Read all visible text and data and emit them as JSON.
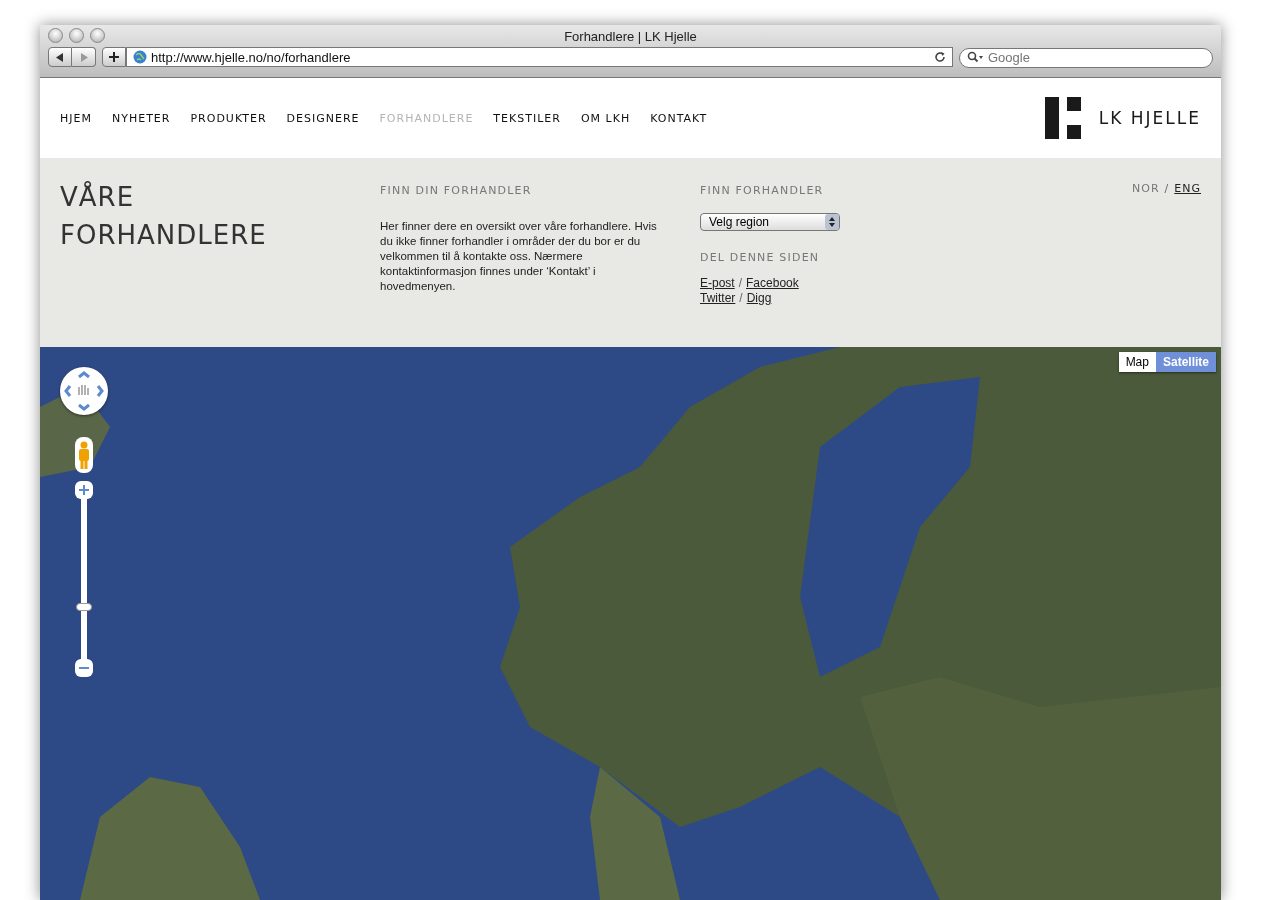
{
  "window": {
    "title": "Forhandlere | LK Hjelle"
  },
  "toolbar": {
    "url": "http://www.hjelle.no/no/forhandlere",
    "search_placeholder": "Google"
  },
  "nav": [
    {
      "label": "HJEM",
      "selected": false
    },
    {
      "label": "NYHETER",
      "selected": false
    },
    {
      "label": "PRODUKTER",
      "selected": false
    },
    {
      "label": "DESIGNERE",
      "selected": false
    },
    {
      "label": "FORHANDLERE",
      "selected": true
    },
    {
      "label": "TEKSTILER",
      "selected": false
    },
    {
      "label": "OM LKH",
      "selected": false
    },
    {
      "label": "KONTAKT",
      "selected": false
    }
  ],
  "logo": {
    "text": "LK HJELLE"
  },
  "page_title": "VÅRE FORHANDLERE",
  "intro": {
    "heading": "FINN DIN FORHANDLER",
    "text": "Her finner dere en oversikt over våre forhandlere. Hvis du ikke finner forhandler i områder der du bor er du velkommen til å kontakte oss. Nærmere kontaktinformasjon finnes under ‘Kontakt’ i hovedmenyen."
  },
  "finder": {
    "heading": "FINN FORHANDLER",
    "region_select": "Velg region",
    "share_heading": "DEL DENNE SIDEN",
    "separator": "/",
    "share_rows": [
      [
        "E-post",
        "Facebook"
      ],
      [
        "Twitter",
        "Digg"
      ]
    ]
  },
  "languages": {
    "separator": "/",
    "items": [
      {
        "label": "NOR",
        "selected": true
      },
      {
        "label": "ENG",
        "selected": false
      }
    ]
  },
  "map": {
    "types": [
      {
        "label": "Map",
        "selected": false
      },
      {
        "label": "Satellite",
        "selected": true
      }
    ],
    "zoom": {
      "level": 0.3
    }
  }
}
